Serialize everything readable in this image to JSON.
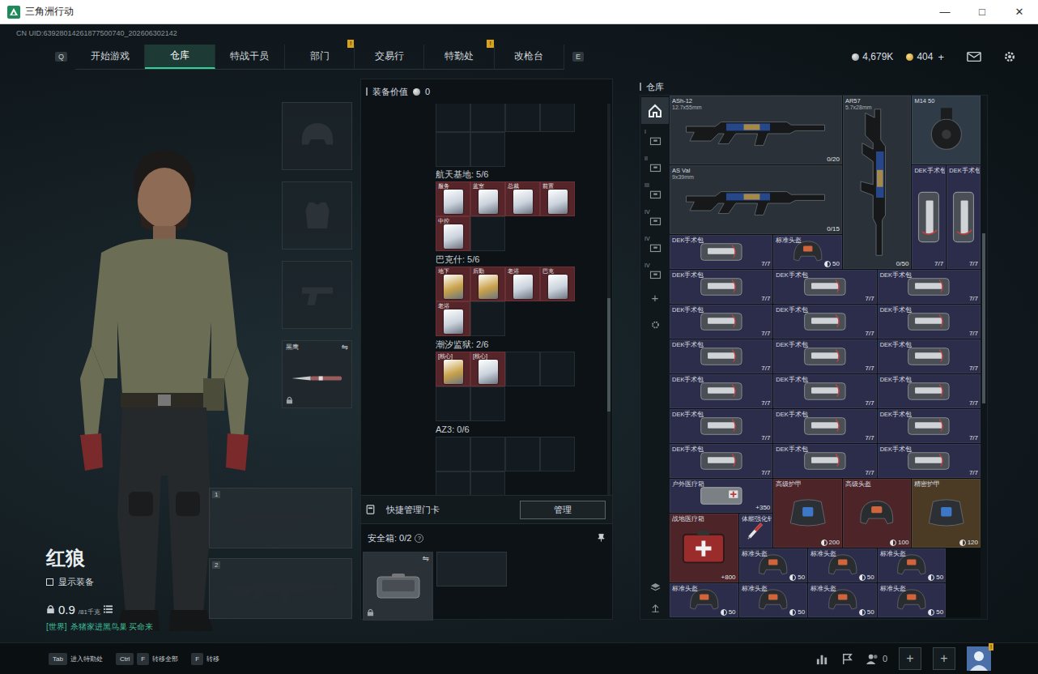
{
  "window": {
    "title": "三角洲行动",
    "controls": [
      "—",
      "□",
      "✕"
    ]
  },
  "uid": "CN UID:63928014261877500740_202606302142",
  "nav": {
    "left_key": "Q",
    "right_key": "E",
    "tabs": [
      {
        "label": "开始游戏",
        "selected": false
      },
      {
        "label": "仓库",
        "selected": true
      },
      {
        "label": "特战干员",
        "selected": false
      },
      {
        "label": "部门",
        "selected": false,
        "badge": "!"
      },
      {
        "label": "交易行",
        "selected": false
      },
      {
        "label": "特勤处",
        "selected": false,
        "badge": "!"
      },
      {
        "label": "改枪台",
        "selected": false
      }
    ]
  },
  "currency": [
    {
      "amount": "4,679K",
      "kind": "silver"
    },
    {
      "amount": "404",
      "action": "+",
      "kind": "gold"
    }
  ],
  "operator": {
    "name": "红狼",
    "show_equipment": {
      "label": "显示装备",
      "checked": false
    },
    "weight": "0.9",
    "weight_max": "/81千克",
    "chat": {
      "channel": "[世界]",
      "message": "杀猪家进黑鸟巢 买命来"
    }
  },
  "gear_slots": [
    {
      "kind": "helmet",
      "filled": false
    },
    {
      "kind": "armor",
      "filled": false
    },
    {
      "kind": "pistol",
      "filled": false
    },
    {
      "kind": "melee",
      "filled": true,
      "name": "黑鹰",
      "swap": "⇋",
      "locked": true
    }
  ],
  "weapon_slots": [
    {
      "index": "1"
    },
    {
      "index": "2"
    }
  ],
  "loadout": {
    "value_label": "装备价值",
    "value": "0",
    "keycards": [
      {
        "map": "航天基地: 5/6",
        "cards": [
          {
            "label": "服务",
            "color": "#c9d2dc"
          },
          {
            "label": "蓝室",
            "color": "#c9d2dc"
          },
          {
            "label": "总裁",
            "color": "#c9d2dc"
          },
          {
            "label": "前置",
            "color": "#c9d2dc"
          },
          {
            "label": "中控",
            "color": "#c9d2dc"
          }
        ]
      },
      {
        "map": "巴克什: 5/6",
        "cards": [
          {
            "label": "地下",
            "color": "#c9a24a"
          },
          {
            "label": "后勤",
            "color": "#c9a24a"
          },
          {
            "label": "老浴",
            "color": "#c9d2dc"
          },
          {
            "label": "巴克",
            "color": "#c9d2dc"
          },
          {
            "label": "老浴",
            "color": "#c9d2dc"
          }
        ]
      },
      {
        "map": "潮汐监狱: 2/6",
        "cards": [
          {
            "label": "[核心]",
            "color": "#c9a24a"
          },
          {
            "label": "[核心]",
            "color": "#c9d2dc"
          }
        ]
      },
      {
        "map": "AZ3: 0/6",
        "cards": []
      }
    ],
    "quick_manage": {
      "label": "快捷管理门卡",
      "button": "管理"
    },
    "safebox": {
      "label": "安全箱: 0/2",
      "help": "?",
      "swap": "⇋",
      "locked": true
    }
  },
  "warehouse": {
    "title": "仓库",
    "sidebar": [
      {
        "kind": "home",
        "selected": true
      },
      {
        "kind": "box",
        "label": "I",
        "selected": false
      },
      {
        "kind": "box",
        "label": "II",
        "selected": false
      },
      {
        "kind": "box",
        "label": "III",
        "selected": false
      },
      {
        "kind": "box",
        "label": "IV",
        "selected": false
      },
      {
        "kind": "box",
        "label": "IV",
        "selected": false
      },
      {
        "kind": "box",
        "label": "IV",
        "selected": false
      },
      {
        "kind": "add",
        "label": "+",
        "selected": false
      },
      {
        "kind": "settings",
        "selected": false
      }
    ],
    "items": [
      {
        "name": "ASh-12",
        "sub": "12.7x55mm",
        "count": "0/20",
        "kind": "rifle",
        "color": "#2a3138"
      },
      {
        "name": "AR57",
        "sub": "5.7x28mm",
        "count": "0/50",
        "kind": "rifle-vertical",
        "color": "#2a3138"
      },
      {
        "name": "M14 50",
        "kind": "drum-mag",
        "color": "#2f3c48"
      },
      {
        "name": "AS Val",
        "sub": "9x39mm",
        "count": "0/15",
        "kind": "rifle",
        "color": "#2a3138"
      },
      {
        "name": "DEK手术包",
        "count": "7/7",
        "kind": "surgical-kit-vertical",
        "color": "#2c2d4a"
      },
      {
        "name": "DEK手术包",
        "count": "7/7",
        "kind": "surgical-kit-vertical",
        "color": "#2c2d4a"
      },
      {
        "name": "DEK手术包",
        "count": "7/7",
        "kind": "surgical-kit",
        "color": "#2c2d4a"
      },
      {
        "name": "标准头盔",
        "count": "50",
        "kind": "helmet",
        "color": "#2c2d4a"
      },
      {
        "name": "DEK手术包",
        "count": "7/7",
        "kind": "surgical-kit",
        "color": "#2c2d4a"
      },
      {
        "name": "DEK手术包",
        "count": "7/7",
        "kind": "surgical-kit",
        "color": "#2c2d4a"
      },
      {
        "name": "DEK手术包",
        "count": "7/7",
        "kind": "surgical-kit",
        "color": "#2c2d4a"
      },
      {
        "name": "DEK手术包",
        "count": "7/7",
        "kind": "surgical-kit",
        "color": "#2c2d4a"
      },
      {
        "name": "DEK手术包",
        "count": "7/7",
        "kind": "surgical-kit",
        "color": "#2c2d4a"
      },
      {
        "name": "DEK手术包",
        "count": "7/7",
        "kind": "surgical-kit",
        "color": "#2c2d4a"
      },
      {
        "name": "DEK手术包",
        "count": "7/7",
        "kind": "surgical-kit",
        "color": "#2c2d4a"
      },
      {
        "name": "DEK手术包",
        "count": "7/7",
        "kind": "surgical-kit",
        "color": "#2c2d4a"
      },
      {
        "name": "DEK手术包",
        "count": "7/7",
        "kind": "surgical-kit",
        "color": "#2c2d4a"
      },
      {
        "name": "DEK手术包",
        "count": "7/7",
        "kind": "surgical-kit",
        "color": "#2c2d4a"
      },
      {
        "name": "DEK手术包",
        "count": "7/7",
        "kind": "surgical-kit",
        "color": "#2c2d4a"
      },
      {
        "name": "DEK手术包",
        "count": "7/7",
        "kind": "surgical-kit",
        "color": "#2c2d4a"
      },
      {
        "name": "DEK手术包",
        "count": "7/7",
        "kind": "surgical-kit",
        "color": "#2c2d4a"
      },
      {
        "name": "DEK手术包",
        "count": "7/7",
        "kind": "surgical-kit",
        "color": "#2c2d4a"
      },
      {
        "name": "DEK手术包",
        "count": "7/7",
        "kind": "surgical-kit",
        "color": "#2c2d4a"
      },
      {
        "name": "DEK手术包",
        "count": "7/7",
        "kind": "surgical-kit",
        "color": "#2c2d4a"
      },
      {
        "name": "DEK手术包",
        "count": "7/7",
        "kind": "surgical-kit",
        "color": "#2c2d4a"
      },
      {
        "name": "DEK手术包",
        "count": "7/7",
        "kind": "surgical-kit",
        "color": "#2c2d4a"
      },
      {
        "name": "户外医疗箱",
        "count": "+350",
        "kind": "outdoor-medkit",
        "color": "#2c2d4a"
      },
      {
        "name": "高级护甲",
        "count": "200",
        "kind": "armor",
        "color": "#4d2428"
      },
      {
        "name": "高级头盔",
        "count": "100",
        "kind": "helmet",
        "color": "#4d2428"
      },
      {
        "name": "精密护甲",
        "count": "120",
        "kind": "armor",
        "color": "#4b3b25"
      },
      {
        "name": "战地医疗箱",
        "count": "+800",
        "kind": "field-medkit",
        "color": "#4d2428"
      },
      {
        "name": "体能强化针",
        "kind": "injector",
        "color": "#2c2d4a"
      },
      {
        "name": "标准头盔",
        "count": "50",
        "kind": "helmet",
        "color": "#2c2d4a"
      },
      {
        "name": "标准头盔",
        "count": "50",
        "kind": "helmet",
        "color": "#2c2d4a"
      },
      {
        "name": "标准头盔",
        "count": "50",
        "kind": "helmet",
        "color": "#2c2d4a"
      },
      {
        "name": "标准头盔",
        "count": "50",
        "kind": "helmet",
        "color": "#2c2d4a"
      },
      {
        "name": "标准头盔",
        "count": "50",
        "kind": "helmet",
        "color": "#2c2d4a"
      },
      {
        "name": "标准头盔",
        "count": "50",
        "kind": "helmet",
        "color": "#2c2d4a"
      },
      {
        "name": "标准头盔",
        "count": "50",
        "kind": "helmet",
        "color": "#2c2d4a"
      }
    ]
  },
  "hints": [
    {
      "keys": [
        "Tab"
      ],
      "label": "进入特勤处"
    },
    {
      "keys": [
        "Ctrl",
        "F"
      ],
      "label": "转移全部"
    },
    {
      "keys": [
        "F"
      ],
      "label": "转移"
    }
  ],
  "social": {
    "friends": "0",
    "buttons": [
      "+",
      "+"
    ],
    "avatar_badge": "!"
  }
}
